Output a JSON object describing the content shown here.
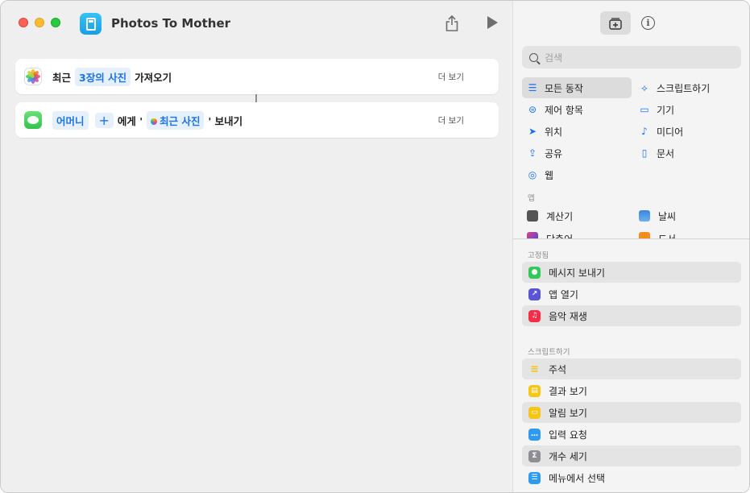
{
  "window": {
    "title": "Photos To Mother"
  },
  "actions": [
    {
      "prefix": "최근",
      "token": "3장의 사진",
      "suffix": "가져오기",
      "more": "더 보기"
    },
    {
      "recipient": "어머니",
      "plus": "+",
      "mid": "에게 '",
      "var_token": "최근 사진",
      "suffix": "' 보내기",
      "more": "더 보기"
    }
  ],
  "sidebar": {
    "search_placeholder": "검색",
    "categories": [
      {
        "label": "모든 동작",
        "icon": "list-icon",
        "selected": true
      },
      {
        "label": "스크립트하기",
        "icon": "scripting-icon"
      },
      {
        "label": "제어 항목",
        "icon": "toggle-icon"
      },
      {
        "label": "기기",
        "icon": "display-icon"
      },
      {
        "label": "위치",
        "icon": "location-arrow-icon"
      },
      {
        "label": "미디어",
        "icon": "music-note-icon"
      },
      {
        "label": "공유",
        "icon": "share-icon"
      },
      {
        "label": "문서",
        "icon": "document-icon"
      },
      {
        "label": "웹",
        "icon": "compass-icon"
      }
    ],
    "apps_label": "앱",
    "apps": [
      {
        "label": "계산기",
        "icon": "calculator-app-icon"
      },
      {
        "label": "날씨",
        "icon": "weather-app-icon"
      },
      {
        "label": "단축어",
        "icon": "shortcuts-app-icon"
      },
      {
        "label": "도서",
        "icon": "books-app-icon"
      }
    ],
    "pinned_label": "고정됨",
    "pinned": [
      {
        "label": "메시지 보내기",
        "icon": "messages-icon",
        "color": "#34c759"
      },
      {
        "label": "앱 열기",
        "icon": "open-app-icon",
        "color": "#5856d6"
      },
      {
        "label": "음악 재생",
        "icon": "music-icon",
        "color": "#fa2d48"
      }
    ],
    "scripting_label": "스크립트하기",
    "scripting": [
      {
        "label": "주석",
        "icon": "comment-lines-icon",
        "color": "#f5c518"
      },
      {
        "label": "결과 보기",
        "icon": "show-result-icon",
        "color": "#f5c518"
      },
      {
        "label": "알림 보기",
        "icon": "alert-icon",
        "color": "#f5c518"
      },
      {
        "label": "입력 요청",
        "icon": "ask-input-icon",
        "color": "#2f9bf0"
      },
      {
        "label": "개수 세기",
        "icon": "count-sigma-icon",
        "color": "#8e8e93"
      },
      {
        "label": "메뉴에서 선택",
        "icon": "choose-menu-icon",
        "color": "#2f9bf0"
      }
    ]
  }
}
